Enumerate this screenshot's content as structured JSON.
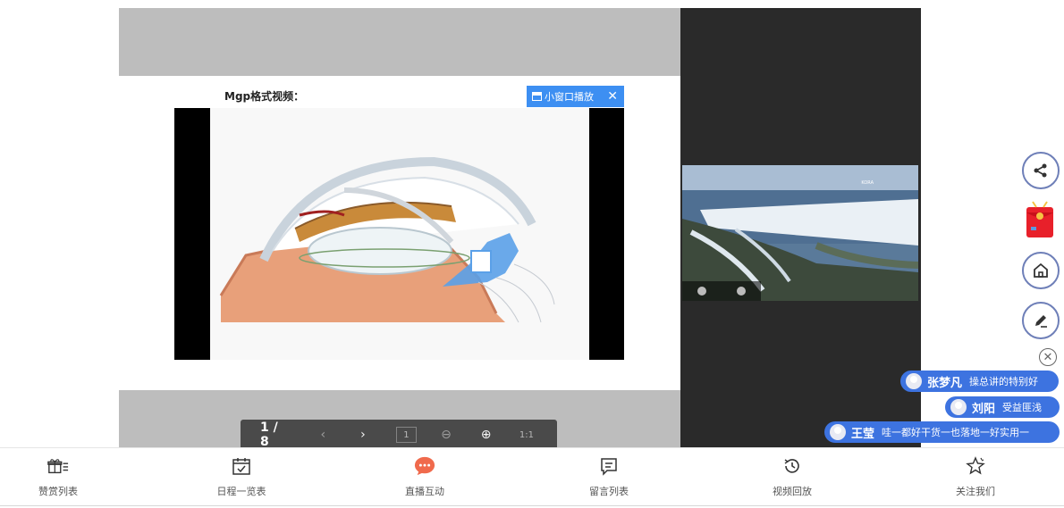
{
  "slide": {
    "title": "Mgp格式视频：",
    "mini_window_label": "小窗口播放",
    "close_glyph": "✕"
  },
  "pager": {
    "page_indicator": "1 / 8",
    "prev_glyph": "‹",
    "next_glyph": "›",
    "fit_label": "1",
    "zoom_out_glyph": "⊖",
    "zoom_in_glyph": "⊕",
    "actual_size_label": "1:1"
  },
  "camera": {
    "label": "KORA"
  },
  "danmu": [
    {
      "name": "张梦凡",
      "message": "操总讲的特别好"
    },
    {
      "name": "刘阳",
      "message": "受益匪浅"
    },
    {
      "name": "王莹",
      "message": "哇一都好干货一也落地一好实用一"
    }
  ],
  "side_close_glyph": "✕",
  "bottom_nav": [
    {
      "label": "赞赏列表",
      "icon": "gift-list-icon"
    },
    {
      "label": "日程一览表",
      "icon": "calendar-icon"
    },
    {
      "label": "直播互动",
      "icon": "chat-bubble-icon"
    },
    {
      "label": "留言列表",
      "icon": "message-list-icon"
    },
    {
      "label": "视频回放",
      "icon": "replay-clock-icon"
    },
    {
      "label": "关注我们",
      "icon": "follow-star-icon"
    }
  ],
  "colors": {
    "accent_blue": "#3d73e0",
    "badge_blue": "#3d8ff2",
    "float_border": "#6e7fb8",
    "chat_icon": "#f06a4c"
  }
}
